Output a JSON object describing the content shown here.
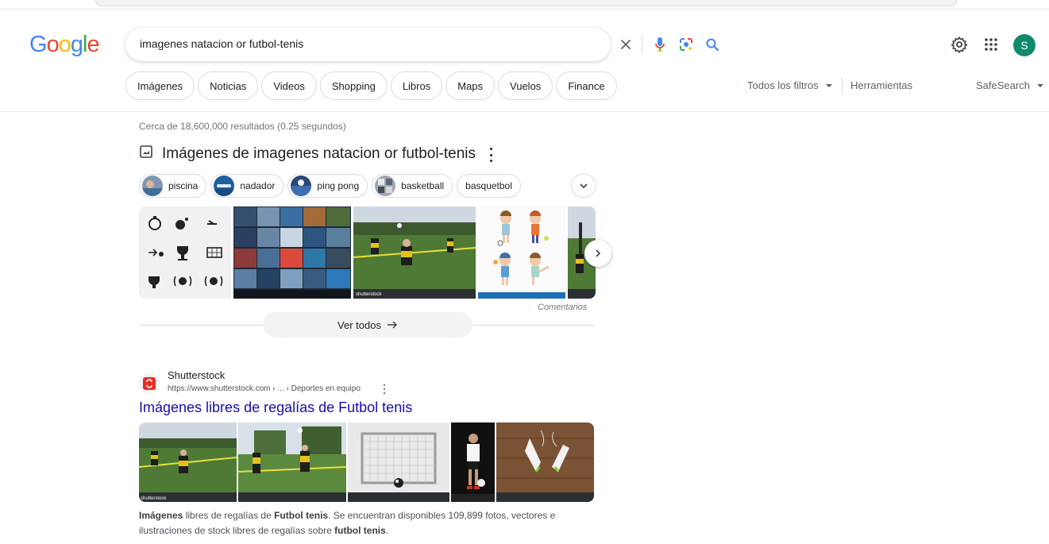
{
  "header": {
    "logo_letters": [
      "G",
      "o",
      "o",
      "g",
      "l",
      "e"
    ],
    "search_value": "imagenes natacion or futbol-tenis",
    "avatar_letter": "S",
    "icons": [
      "clear-icon",
      "mic-icon",
      "lens-icon",
      "search-icon",
      "settings-icon",
      "apps-icon"
    ]
  },
  "tabs": [
    "Imágenes",
    "Noticias",
    "Videos",
    "Shopping",
    "Libros",
    "Maps",
    "Vuelos",
    "Finance"
  ],
  "tools": {
    "all_filters": "Todos los filtros",
    "tools": "Herramientas",
    "safesearch": "SafeSearch"
  },
  "stats": "Cerca de 18,600,000 resultados (0.25 segundos)",
  "images_block": {
    "title": "Imágenes de imagenes natacion or futbol-tenis",
    "chips": [
      "piscina",
      "nadador",
      "ping pong",
      "basketball",
      "basquetbol"
    ],
    "feedback": "Comentarios",
    "see_all": "Ver todos",
    "watermark": "shutterstock"
  },
  "result": {
    "site_name": "Shutterstock",
    "url": "https://www.shutterstock.com › ... › Deportes en equipo",
    "title": "Imágenes libres de regalías de Futbol tenis",
    "snippet_parts": [
      "Imágenes",
      " libres de regalías de ",
      "Futbol tenis",
      ". Se encuentran disponibles 109,899 fotos, vectores e ilustraciones de stock libres de regalías sobre ",
      "futbol tenis",
      "."
    ],
    "watermark": "shutterstock"
  },
  "colors": {
    "google_blue": "#4285f4",
    "google_red": "#ea4335",
    "google_yellow": "#fbbc05",
    "google_green": "#34a853",
    "link": "#1a0dab",
    "avatar": "#0f8a6b",
    "shutterstock_red": "#ee2b24"
  }
}
